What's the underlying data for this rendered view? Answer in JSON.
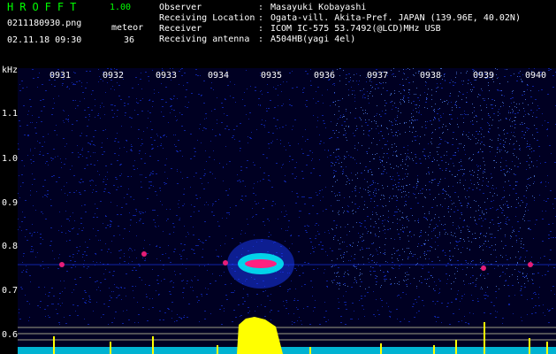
{
  "header": {
    "app_title": "HROFFT",
    "app_version": "1.00",
    "file_name": "0211180930.png",
    "meteor_label": "meteor",
    "timestamp": "02.11.18 09:30",
    "meteor_count": "36"
  },
  "info": [
    {
      "label": "Observer",
      "sep": ":",
      "value": "Masayuki Kobayashi"
    },
    {
      "label": "Receiving Location",
      "sep": ":",
      "value": "Ogata-vill. Akita-Pref. JAPAN (139.96E, 40.02N)"
    },
    {
      "label": "Receiver",
      "sep": ":",
      "value": "ICOM IC-575 53.7492(@LCD)MHz USB"
    },
    {
      "label": "Receiving antenna",
      "sep": ":",
      "value": "A504HB(yagi 4el)"
    }
  ],
  "spectrogram": {
    "y_unit": "kHz",
    "y_ticks": [
      "1.1",
      "1.0",
      "0.9",
      "0.8",
      "0.7",
      "0.6"
    ],
    "x_ticks": [
      "0931",
      "0932",
      "0933",
      "0934",
      "0935",
      "0936",
      "0937",
      "0938",
      "0939",
      "0940"
    ],
    "colors": {
      "background": "#000022",
      "noise": "#1a3cff",
      "signal_mid": "#00ffff",
      "signal_high": "#ff2080",
      "level_bar": "#ffff00",
      "level_floor": "#00e0ff",
      "level_line": "#c8c8a0"
    }
  }
}
